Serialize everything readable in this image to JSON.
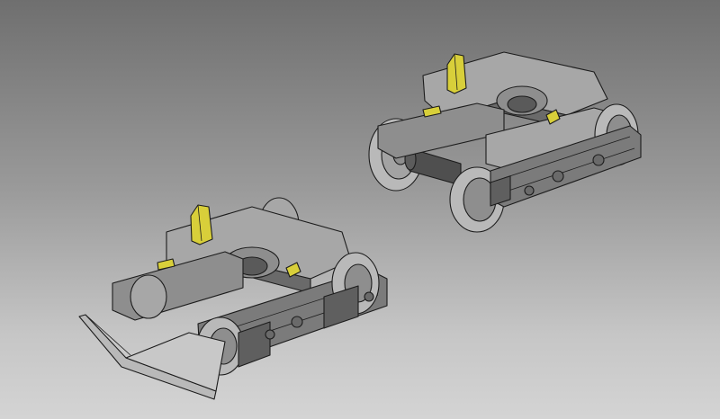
{
  "scene": {
    "background": {
      "top": "#6f6f6f",
      "bottom": "#d4d4d4"
    },
    "colors": {
      "frame_light": "#a7a7a7",
      "frame_mid": "#8e8e8e",
      "frame_dark": "#6a6a6a",
      "frame_shadow": "#4a4a4a",
      "wheel_face": "#b9b9b9",
      "axle": "#4f4f4f",
      "highlight_part": "#d8cf3a",
      "outline": "#1c1c1c"
    },
    "objects": [
      {
        "name": "bogie-rear",
        "parts": [
          "side-frame",
          "bolster",
          "wheelset",
          "center-pin"
        ]
      },
      {
        "name": "bogie-front",
        "parts": [
          "side-frame",
          "bolster",
          "wheelset",
          "center-pin",
          "pilot-plow"
        ]
      }
    ]
  }
}
